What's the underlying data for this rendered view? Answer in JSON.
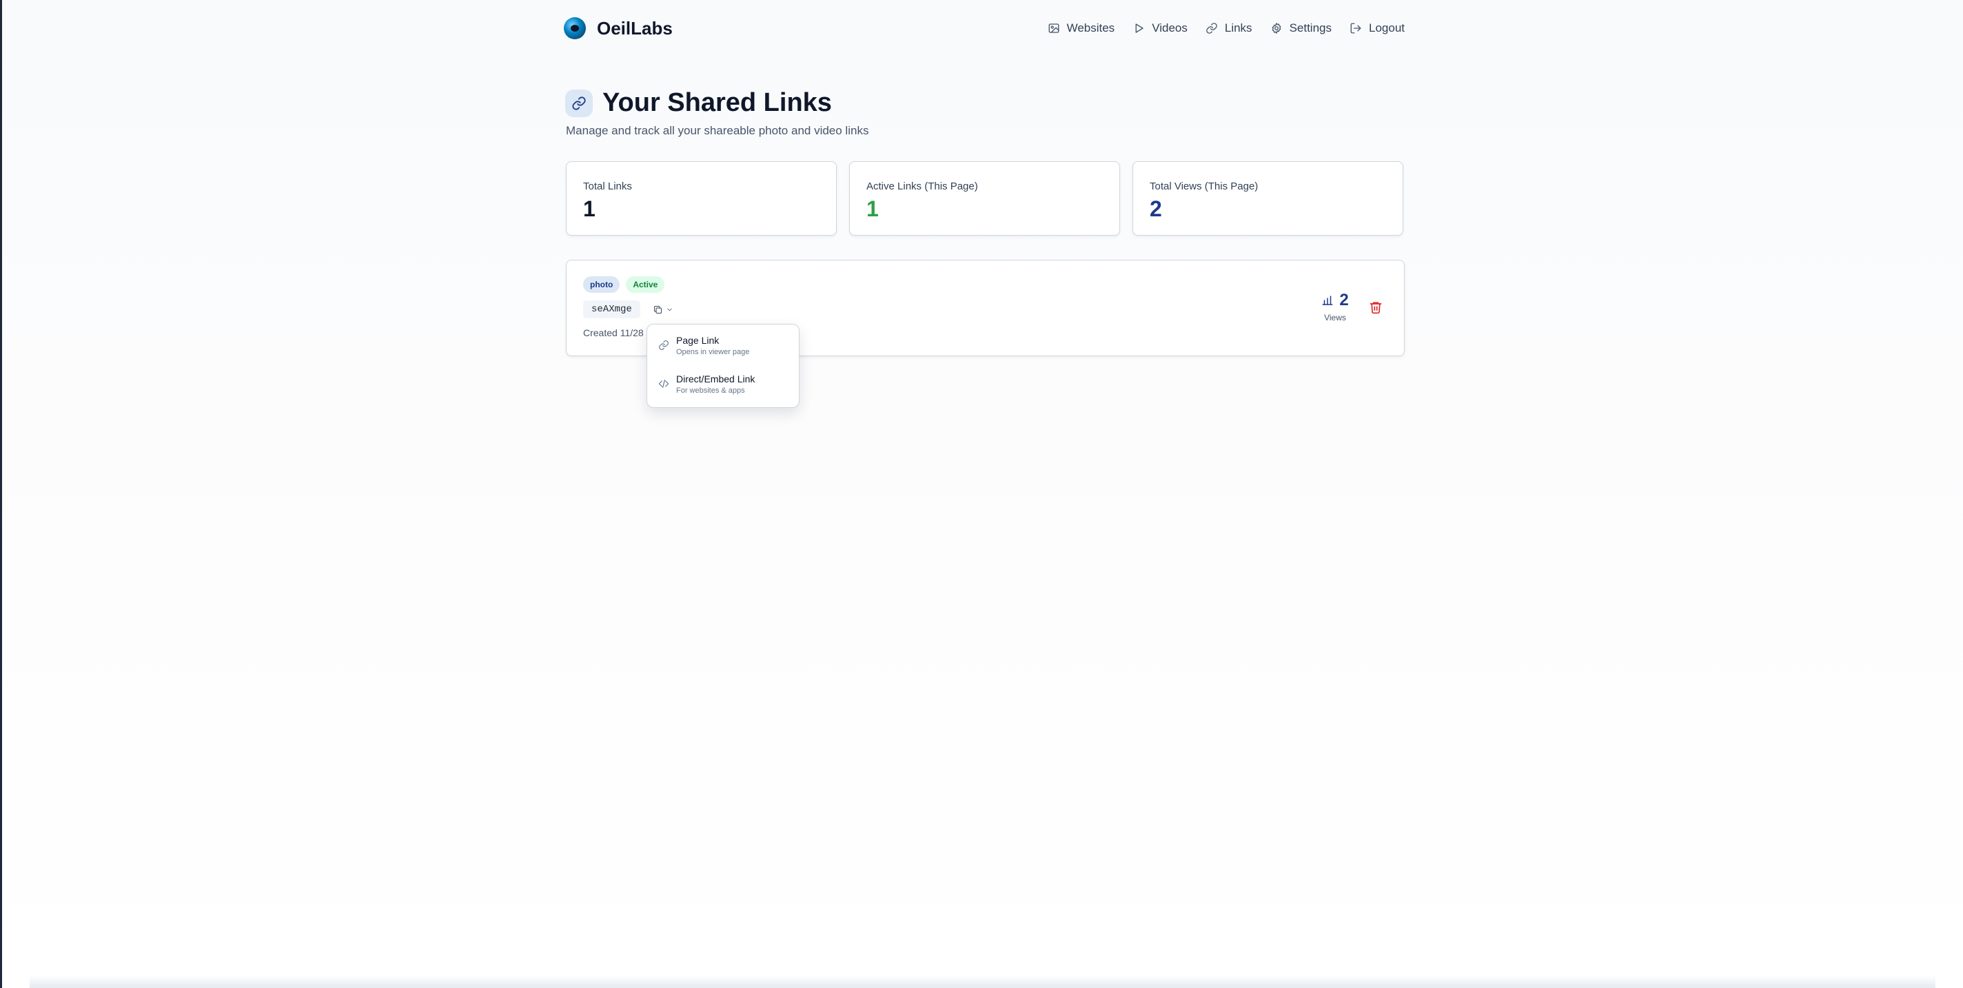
{
  "brand": {
    "name": "OeilLabs"
  },
  "nav": {
    "items": [
      {
        "label": "Websites",
        "icon": "image-icon"
      },
      {
        "label": "Videos",
        "icon": "play-icon"
      },
      {
        "label": "Links",
        "icon": "link-icon"
      },
      {
        "label": "Settings",
        "icon": "gear-icon"
      },
      {
        "label": "Logout",
        "icon": "logout-icon"
      }
    ]
  },
  "page": {
    "title": "Your Shared Links",
    "subtitle": "Manage and track all your shareable photo and video links"
  },
  "stats": [
    {
      "label": "Total Links",
      "value": "1",
      "color": "#0f172a"
    },
    {
      "label": "Active Links (This Page)",
      "value": "1",
      "color": "#2f9e44"
    },
    {
      "label": "Total Views (This Page)",
      "value": "2",
      "color": "#1e3a8a"
    }
  ],
  "link": {
    "type_badge": "photo",
    "status_badge": "Active",
    "code": "seAXmge",
    "created": "Created 11/28",
    "views_count": "2",
    "views_label": "Views"
  },
  "dropdown": {
    "items": [
      {
        "title": "Page Link",
        "desc": "Opens in viewer page",
        "icon": "link-icon"
      },
      {
        "title": "Direct/Embed Link",
        "desc": "For websites & apps",
        "icon": "code-icon"
      }
    ]
  },
  "colors": {
    "accent": "#1e3a8a",
    "success": "#2f9e44",
    "danger": "#dc2626"
  }
}
